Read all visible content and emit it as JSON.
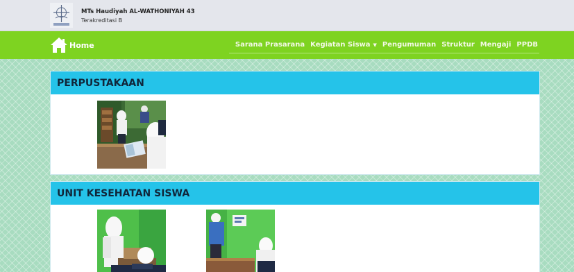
{
  "header": {
    "school_name": "MTs Haudiyah AL-WATHONIYAH 43",
    "accreditation": "Terakreditasi B"
  },
  "navbar": {
    "home_label": "Home",
    "menu": [
      {
        "label": "Sarana Prasarana"
      },
      {
        "label": "Kegiatan Siswa",
        "dropdown": true
      },
      {
        "label": "Pengumuman"
      },
      {
        "label": "Struktur"
      },
      {
        "label": "Mengaji"
      },
      {
        "label": "PPDB"
      }
    ]
  },
  "sections": [
    {
      "title": "PERPUSTAKAAN",
      "photos": [
        "library-photo"
      ]
    },
    {
      "title": "UNIT KESEHATAN SISWA",
      "photos": [
        "health-unit-photo-1",
        "health-unit-photo-2"
      ]
    }
  ],
  "colors": {
    "navbar": "#7ed321",
    "section_header": "#25c3e9",
    "topbar": "#e4e6ec",
    "background": "#a8dcc0"
  }
}
